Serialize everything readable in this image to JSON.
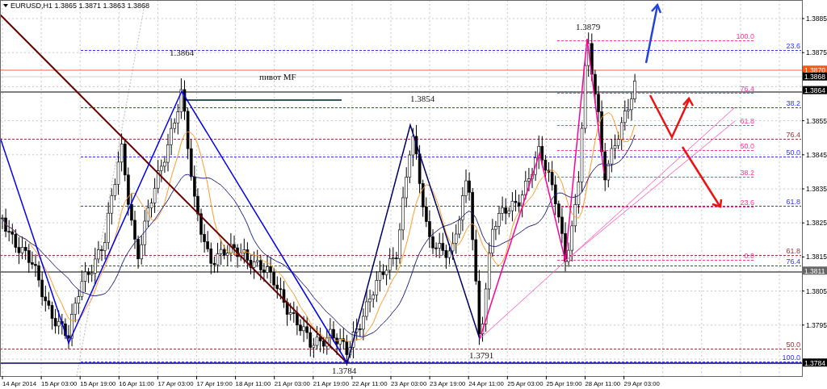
{
  "header": {
    "symbol": "EURUSD,H1",
    "quotes": [
      "1.3865",
      "1.3871",
      "1.3863",
      "1.3868"
    ]
  },
  "price_axis": {
    "ticks": [
      "1.3885",
      "1.3875",
      "1.3855",
      "1.3845",
      "1.3835",
      "1.3825",
      "1.3815",
      "1.3805",
      "1.3795"
    ],
    "badges": [
      {
        "text": "1.3870",
        "kind": "bid"
      },
      {
        "text": "1.3868",
        "kind": "level"
      },
      {
        "text": "1.3864",
        "kind": "level"
      },
      {
        "text": "1.3811",
        "kind": "muted"
      },
      {
        "text": "1.3784",
        "kind": "level"
      }
    ]
  },
  "chart_labels": [
    "1.3879",
    "1.3864",
    "пивот MF",
    "1.3854",
    "1.3791",
    "1.3784"
  ],
  "fib_sets": [
    {
      "color": "#3333ff",
      "labels": [
        "23.6",
        "38.2",
        "50.0",
        "61.8",
        "76.4",
        "100.0"
      ]
    },
    {
      "color": "#ff3399",
      "labels": [
        "100.0",
        "76.4",
        "61.8",
        "50.0",
        "38.2",
        "23.6",
        "0.0"
      ]
    },
    {
      "color": "#993333",
      "labels": [
        "76.4",
        "61.8",
        "50.0"
      ]
    }
  ],
  "time_axis": [
    "14 Apr 2014",
    "15 Apr 03:00",
    "15 Apr 19:00",
    "16 Apr 11:00",
    "17 Apr 03:00",
    "17 Apr 19:00",
    "18 Apr 11:00",
    "21 Apr 03:00",
    "21 Apr 19:00",
    "22 Apr 11:00",
    "23 Apr 03:00",
    "23 Apr 19:00",
    "24 Apr 11:00",
    "25 Apr 03:00",
    "25 Apr 19:00",
    "28 Apr 11:00",
    "29 Apr 03:00"
  ]
}
